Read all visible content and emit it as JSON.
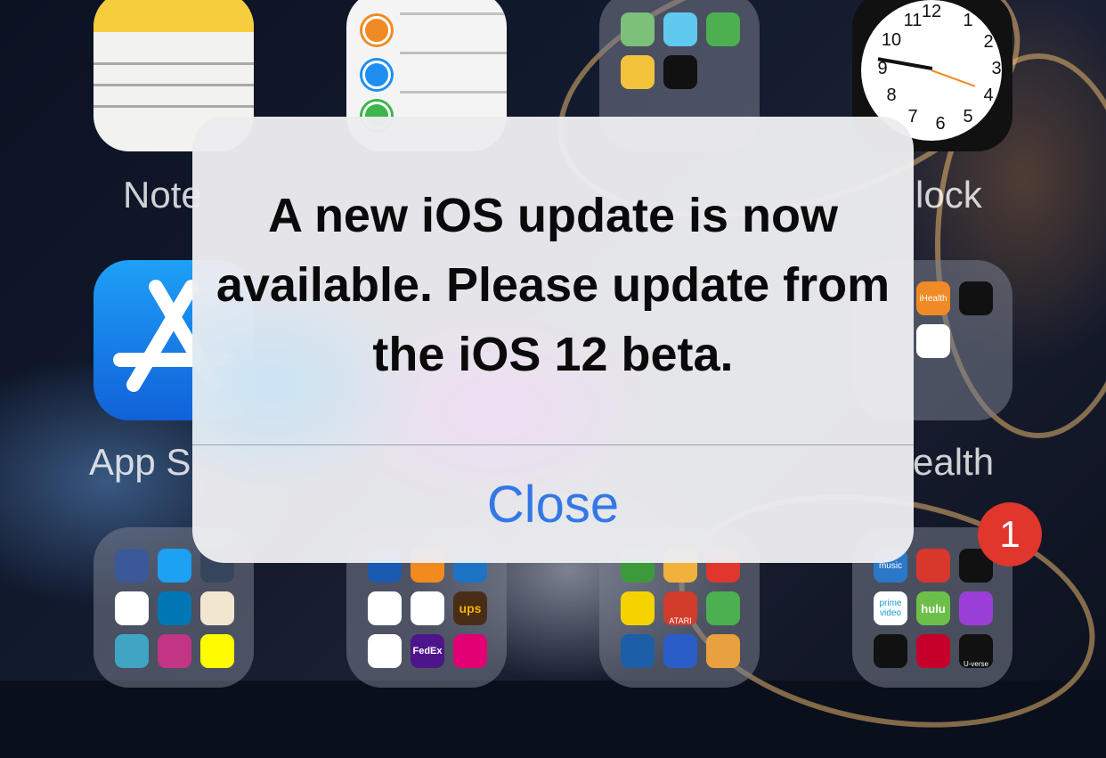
{
  "home": {
    "labels": {
      "notes": "Note",
      "clock": "lock",
      "app_store": "App S",
      "health": "ealth"
    },
    "clock_numbers": [
      "12",
      "1",
      "2",
      "3",
      "4",
      "5",
      "6",
      "7",
      "8",
      "9",
      "10",
      "11"
    ],
    "folder_labels": {
      "ihealth": "iHealth",
      "music": "music",
      "prime": "prime video",
      "hulu": "hulu",
      "ups": "ups",
      "fedex": "FedEx",
      "atari": "ATARI",
      "uverse": "U-verse"
    },
    "badge_count": "1"
  },
  "alert": {
    "message": "A new iOS update is now available. Please update from the iOS 12 beta.",
    "button_label": "Close"
  },
  "colors": {
    "alert_button": "#3478e6",
    "badge": "#e0362c"
  }
}
